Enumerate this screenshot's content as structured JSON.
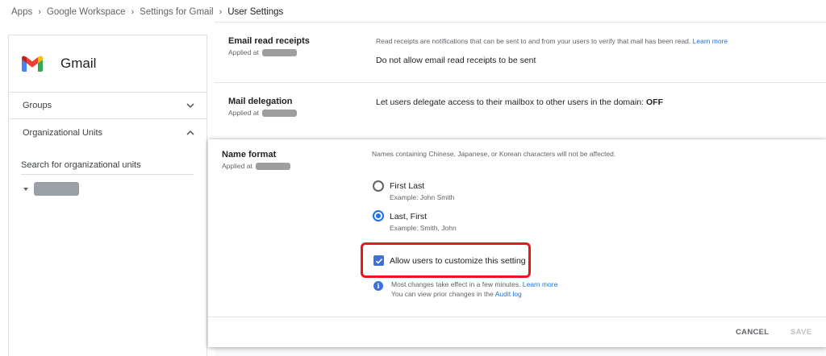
{
  "breadcrumb": {
    "items": [
      "Apps",
      "Google Workspace",
      "Settings for Gmail"
    ],
    "current": "User Settings"
  },
  "sidebar": {
    "app_name": "Gmail",
    "groups_label": "Groups",
    "ou_label": "Organizational Units",
    "search_placeholder": "Search for organizational units"
  },
  "settings": {
    "read_receipts": {
      "label": "Email read receipts",
      "applied_at": "Applied at",
      "description": "Read receipts are notifications that can be sent to and from your users to verify that mail has been read.",
      "learn_more": "Learn more",
      "value": "Do not allow email read receipts to be sent"
    },
    "mail_delegation": {
      "label": "Mail delegation",
      "applied_at": "Applied at",
      "value_prefix": "Let users delegate access to their mailbox to other users in the domain: ",
      "value_state": "OFF"
    },
    "name_format": {
      "label": "Name format",
      "applied_at": "Applied at",
      "description": "Names containing Chinese, Japanese, or Korean characters will not be affected.",
      "options": [
        {
          "label": "First Last",
          "example": "Example: John Smith",
          "selected": false
        },
        {
          "label": "Last, First",
          "example": "Example: Smith, John",
          "selected": true
        }
      ],
      "allow_customize": "Allow users to customize this setting",
      "allow_customize_checked": true,
      "info_line1": "Most changes take effect in a few minutes.",
      "info_learn_more": "Learn more",
      "info_line2": "You can view prior changes in the",
      "audit_log": "Audit log"
    }
  },
  "buttons": {
    "cancel": "CANCEL",
    "save": "SAVE"
  },
  "colors": {
    "accent": "#1a73e8",
    "highlight": "#e8191d",
    "checkbox": "#3f6fd8"
  }
}
